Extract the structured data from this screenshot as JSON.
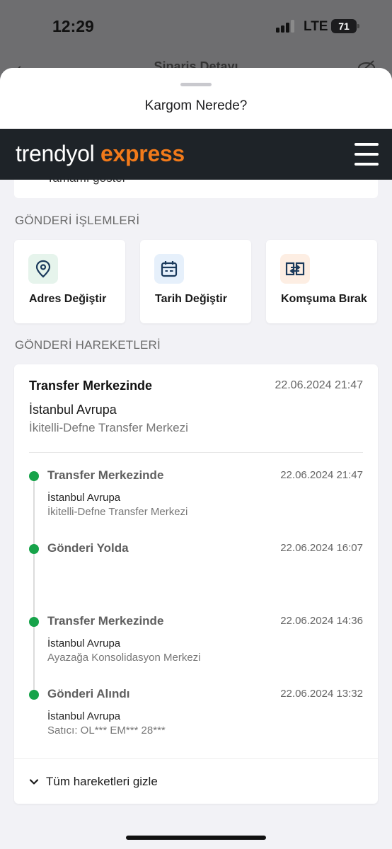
{
  "status_bar": {
    "time": "12:29",
    "network": "LTE",
    "battery": "71"
  },
  "behind": {
    "title": "Sipariş Detayı"
  },
  "sheet": {
    "title": "Kargom Nerede?"
  },
  "brand": {
    "word1": "trendyol",
    "word2": " express"
  },
  "collapsed_item": {
    "label": "Tamamı göster"
  },
  "actions": {
    "section_title": "GÖNDERİ İŞLEMLERİ",
    "items": [
      {
        "label": "Adres Değiştir",
        "icon": "location-pin-icon",
        "icon_bg": "#e6f4ec",
        "icon_color": "#1b3a5c"
      },
      {
        "label": "Tarih Değiştir",
        "icon": "calendar-icon",
        "icon_bg": "#e6f0fb",
        "icon_color": "#1b3a5c"
      },
      {
        "label": "Komşuma Bırak",
        "icon": "handoff-icon",
        "icon_bg": "#fdeee3",
        "icon_color": "#1b3a5c"
      }
    ]
  },
  "movements": {
    "section_title": "GÖNDERİ HAREKETLERİ",
    "current": {
      "status": "Transfer Merkezinde",
      "datetime": "22.06.2024 21:47",
      "city": "İstanbul Avrupa",
      "place": "İkitelli-Defne Transfer Merkezi"
    },
    "events": [
      {
        "status": "Transfer Merkezinde",
        "datetime": "22.06.2024 21:47",
        "city": "İstanbul Avrupa",
        "place": "İkitelli-Defne Transfer Merkezi"
      },
      {
        "status": "Gönderi Yolda",
        "datetime": "22.06.2024 16:07",
        "city": "",
        "place": ""
      },
      {
        "status": "Transfer Merkezinde",
        "datetime": "22.06.2024 14:36",
        "city": "İstanbul Avrupa",
        "place": "Ayazağa Konsolidasyon Merkezi"
      },
      {
        "status": "Gönderi Alındı",
        "datetime": "22.06.2024 13:32",
        "city": "İstanbul Avrupa",
        "place": "Satıcı: OL*** EM*** 28***"
      }
    ],
    "toggle_label": "Tüm hareketleri gizle"
  },
  "colors": {
    "brand_dark": "#1e2328",
    "brand_orange": "#f27a1a",
    "timeline_green": "#17a34a"
  }
}
